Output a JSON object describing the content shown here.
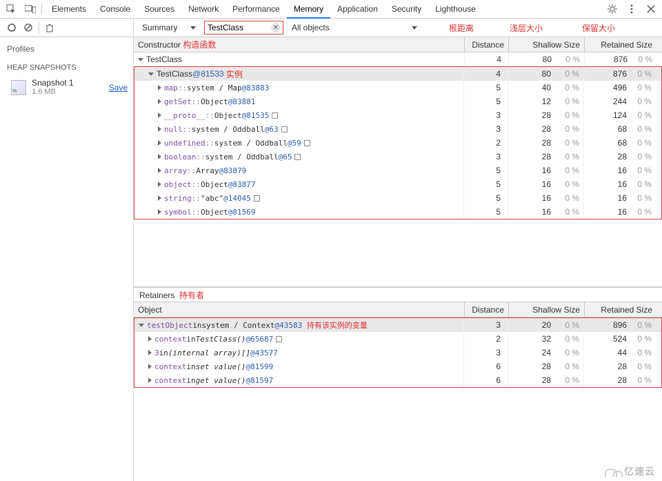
{
  "top_tabs": {
    "items": [
      "Elements",
      "Console",
      "Sources",
      "Network",
      "Performance",
      "Memory",
      "Application",
      "Security",
      "Lighthouse"
    ],
    "active_index": 5
  },
  "toolbar": {
    "summary_label": "Summary",
    "filter_value": "TestClass",
    "objects_label": "All objects"
  },
  "annotations": {
    "distance": "根距离",
    "shallow": "浅层大小",
    "retained": "保留大小",
    "constructor_fn": "构造函数",
    "instance": "实例",
    "retainers": "持有者",
    "owner_var": "持有该实例的变量"
  },
  "sidebar": {
    "profiles_label": "Profiles",
    "category_label": "HEAP SNAPSHOTS",
    "snapshot": {
      "name": "Snapshot 1",
      "size": "1.6 MB",
      "save_label": "Save"
    }
  },
  "constructors": {
    "columns": {
      "constructor": "Constructor",
      "distance": "Distance",
      "shallow": "Shallow Size",
      "retained": "Retained Size"
    },
    "root": {
      "label": "TestClass",
      "distance": "4",
      "shallow_v": "80",
      "shallow_p": "0 %",
      "retained_v": "876",
      "retained_p": "0 %",
      "expanded": true
    },
    "instance": {
      "prefix": "TestClass",
      "id": " @81533",
      "distance": "4",
      "shallow_v": "80",
      "shallow_p": "0 %",
      "retained_v": "876",
      "retained_p": "0 %"
    },
    "children": [
      {
        "name": "map",
        "sep": " :: ",
        "type": "system / Map",
        "id": " @83883",
        "sq": false,
        "distance": "5",
        "shallow_v": "40",
        "shallow_p": "0 %",
        "retained_v": "496",
        "retained_p": "0 %"
      },
      {
        "name": "getSet",
        "sep": " :: ",
        "type": "Object",
        "id": " @83881",
        "sq": false,
        "distance": "5",
        "shallow_v": "12",
        "shallow_p": "0 %",
        "retained_v": "244",
        "retained_p": "0 %"
      },
      {
        "name": "__proto__",
        "sep": " :: ",
        "type": "Object",
        "id": " @81535",
        "sq": true,
        "distance": "3",
        "shallow_v": "28",
        "shallow_p": "0 %",
        "retained_v": "124",
        "retained_p": "0 %"
      },
      {
        "name": "null",
        "sep": " :: ",
        "type": "system / Oddball",
        "id": " @63",
        "sq": true,
        "distance": "3",
        "shallow_v": "28",
        "shallow_p": "0 %",
        "retained_v": "68",
        "retained_p": "0 %"
      },
      {
        "name": "undefined",
        "sep": " :: ",
        "type": "system / Oddball",
        "id": " @59",
        "sq": true,
        "distance": "2",
        "shallow_v": "28",
        "shallow_p": "0 %",
        "retained_v": "68",
        "retained_p": "0 %"
      },
      {
        "name": "boolean",
        "sep": " :: ",
        "type": "system / Oddball",
        "id": " @65",
        "sq": true,
        "distance": "3",
        "shallow_v": "28",
        "shallow_p": "0 %",
        "retained_v": "28",
        "retained_p": "0 %"
      },
      {
        "name": "array",
        "sep": " :: ",
        "type": "Array",
        "id": " @83879",
        "sq": false,
        "distance": "5",
        "shallow_v": "16",
        "shallow_p": "0 %",
        "retained_v": "16",
        "retained_p": "0 %"
      },
      {
        "name": "object",
        "sep": " :: ",
        "type": "Object",
        "id": " @83877",
        "sq": false,
        "distance": "5",
        "shallow_v": "16",
        "shallow_p": "0 %",
        "retained_v": "16",
        "retained_p": "0 %"
      },
      {
        "name": "string",
        "sep": " :: ",
        "type": "\"abc\"",
        "id": " @14045",
        "sq": true,
        "distance": "5",
        "shallow_v": "16",
        "shallow_p": "0 %",
        "retained_v": "16",
        "retained_p": "0 %"
      },
      {
        "name": "symbol",
        "sep": " :: ",
        "type": "Object",
        "id": " @81569",
        "sq": false,
        "distance": "5",
        "shallow_v": "16",
        "shallow_p": "0 %",
        "retained_v": "16",
        "retained_p": "0 %"
      }
    ]
  },
  "retainers": {
    "title": "Retainers",
    "columns": {
      "object": "Object",
      "distance": "Distance",
      "shallow": "Shallow Size",
      "retained": "Retained Size"
    },
    "selected": {
      "text_a": "testObject",
      "text_in": " in ",
      "text_b": "system / Context",
      "id": " @43583",
      "distance": "3",
      "shallow_v": "20",
      "shallow_p": "0 %",
      "retained_v": "896",
      "retained_p": "0 %"
    },
    "rows": [
      {
        "a": "context",
        "in": " in ",
        "b": "TestClass()",
        "id": " @65687",
        "sq": true,
        "distance": "2",
        "shallow_v": "32",
        "shallow_p": "0 %",
        "retained_v": "524",
        "retained_p": "0 %"
      },
      {
        "a": "3",
        "in": " in ",
        "b": "(internal array)[]",
        "id": " @43577",
        "sq": false,
        "distance": "3",
        "shallow_v": "24",
        "shallow_p": "0 %",
        "retained_v": "44",
        "retained_p": "0 %"
      },
      {
        "a": "context",
        "in": " in ",
        "b": "set value()",
        "id": " @81599",
        "sq": false,
        "distance": "6",
        "shallow_v": "28",
        "shallow_p": "0 %",
        "retained_v": "28",
        "retained_p": "0 %"
      },
      {
        "a": "context",
        "in": " in ",
        "b": "get value()",
        "id": " @81597",
        "sq": false,
        "distance": "6",
        "shallow_v": "28",
        "shallow_p": "0 %",
        "retained_v": "28",
        "retained_p": "0 %"
      }
    ]
  },
  "watermark": "亿速云"
}
